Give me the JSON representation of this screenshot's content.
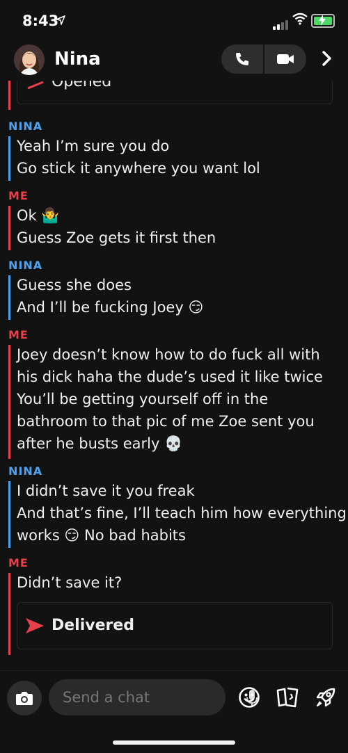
{
  "status_bar": {
    "time": "8:43"
  },
  "header": {
    "contact_name": "Nina"
  },
  "messages": {
    "prev_status": "Opened",
    "nina_label": "NINA",
    "me_label": "ME",
    "g1": [
      "Yeah I’m sure you do",
      "Go stick it anywhere you want lol"
    ],
    "g2": [
      "Ok 🤷‍♂️",
      "Guess Zoe gets it first then"
    ],
    "g3": [
      "Guess she does",
      "And I’ll be fucking Joey 😏"
    ],
    "g4": [
      "Joey doesn’t know how to do fuck all with",
      "his dick haha the dude’s used it like twice",
      "You’ll be getting yourself off in the",
      "bathroom to that pic of me Zoe sent you",
      "after he busts early 💀"
    ],
    "g5": [
      "I didn’t save it you freak",
      "And that’s fine, I’ll teach him how everything",
      "works 😏 No bad habits"
    ],
    "g6": [
      "Didn’t save it?"
    ],
    "delivered_status": "Delivered"
  },
  "composer": {
    "placeholder": "Send a chat"
  },
  "colors": {
    "nina": "#4aa3f0",
    "me": "#e8404a",
    "background": "#121212"
  },
  "icons": [
    "location-arrow-icon",
    "signal-icon",
    "wifi-icon",
    "battery-charging-icon",
    "phone-icon",
    "video-icon",
    "chevron-right-icon",
    "camera-icon",
    "microphone-icon",
    "smiley-icon",
    "cards-icon",
    "rocket-icon"
  ]
}
